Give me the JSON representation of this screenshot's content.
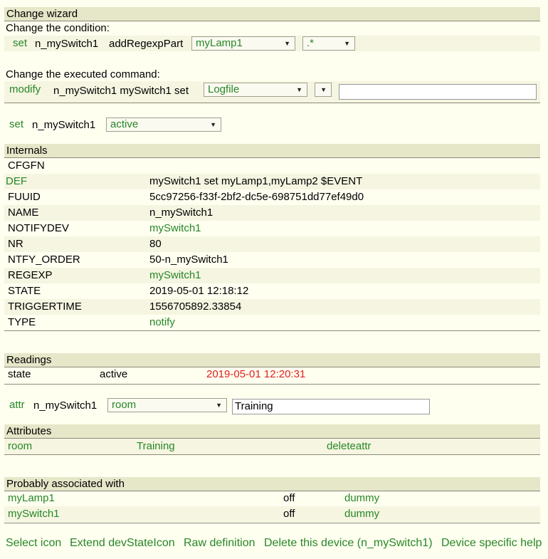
{
  "wizard": {
    "title": "Change wizard",
    "condition_label": "Change the condition:",
    "cond_cmd": "set",
    "cond_device": "n_mySwitch1",
    "cond_part": "addRegexpPart",
    "cond_select1": "myLamp1",
    "cond_select2": ".*",
    "command_label": "Change the executed command:",
    "cmd_cmd": "modify",
    "cmd_text": "n_mySwitch1 mySwitch1 set",
    "cmd_select1": "Logfile",
    "cmd_select2": "",
    "cmd_input": ""
  },
  "setline": {
    "cmd": "set",
    "device": "n_mySwitch1",
    "value": "active"
  },
  "internals": {
    "title": "Internals",
    "first": "CFGFN",
    "rows": [
      {
        "key": "DEF",
        "value": "mySwitch1 set myLamp1,myLamp2 $EVENT"
      },
      {
        "key": "FUUID",
        "value": "5cc97256-f33f-2bf2-dc5e-698751dd77ef49d0"
      },
      {
        "key": "NAME",
        "value": "n_mySwitch1"
      },
      {
        "key": "NOTIFYDEV",
        "value": "mySwitch1"
      },
      {
        "key": "NR",
        "value": "80"
      },
      {
        "key": "NTFY_ORDER",
        "value": "50-n_mySwitch1"
      },
      {
        "key": "REGEXP",
        "value": "mySwitch1"
      },
      {
        "key": "STATE",
        "value": "2019-05-01 12:18:12"
      },
      {
        "key": "TRIGGERTIME",
        "value": "1556705892.33854"
      },
      {
        "key": "TYPE",
        "value": "notify"
      }
    ]
  },
  "readings": {
    "title": "Readings",
    "name": "state",
    "value": "active",
    "time": "2019-05-01 12:20:31"
  },
  "attrline": {
    "cmd": "attr",
    "device": "n_mySwitch1",
    "select": "room",
    "input": "Training"
  },
  "attributes": {
    "title": "Attributes",
    "name": "room",
    "value": "Training",
    "action": "deleteattr"
  },
  "associated": {
    "title": "Probably associated with",
    "rows": [
      {
        "name": "myLamp1",
        "state": "off",
        "type": "dummy"
      },
      {
        "name": "mySwitch1",
        "state": "off",
        "type": "dummy"
      }
    ]
  },
  "footer": {
    "links": [
      "Select icon",
      "Extend devStateIcon",
      "Raw definition",
      "Delete this device (n_mySwitch1)",
      "Device specific help"
    ]
  },
  "colors": {
    "link": "#278727",
    "timestamp": "#e02020",
    "header_bg": "#e6e6c9",
    "page_bg": "#fffff0"
  }
}
